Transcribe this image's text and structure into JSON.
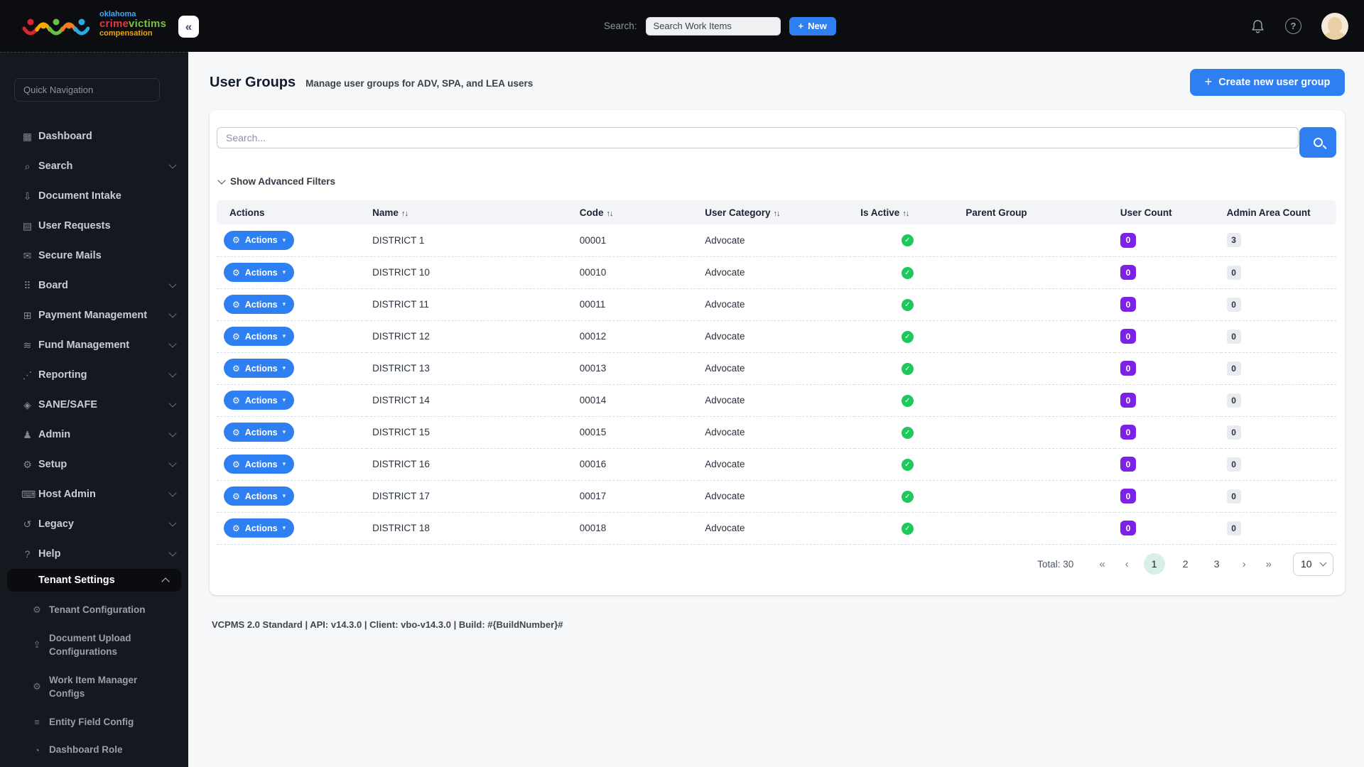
{
  "topbar": {
    "logo": {
      "line1": "oklahoma",
      "line2a": "crime",
      "line2b": "victims",
      "line3": "compensation"
    },
    "search_label": "Search:",
    "search_placeholder": "Search Work Items",
    "new_button_label": "New"
  },
  "sidebar": {
    "quick_nav_placeholder": "Quick Navigation",
    "items": [
      {
        "label": "Dashboard",
        "icon": "dashboard-icon",
        "chevron": false,
        "active": false
      },
      {
        "label": "Search",
        "icon": "search-icon",
        "chevron": true,
        "active": false
      },
      {
        "label": "Document Intake",
        "icon": "document-intake-icon",
        "chevron": false,
        "active": false
      },
      {
        "label": "User Requests",
        "icon": "user-requests-icon",
        "chevron": false,
        "active": false
      },
      {
        "label": "Secure Mails",
        "icon": "secure-mails-icon",
        "chevron": false,
        "active": false
      },
      {
        "label": "Board",
        "icon": "board-icon",
        "chevron": true,
        "active": false
      },
      {
        "label": "Payment Management",
        "icon": "payment-management-icon",
        "chevron": true,
        "active": false
      },
      {
        "label": "Fund Management",
        "icon": "fund-management-icon",
        "chevron": true,
        "active": false
      },
      {
        "label": "Reporting",
        "icon": "reporting-icon",
        "chevron": true,
        "active": false
      },
      {
        "label": "SANE/SAFE",
        "icon": "shield-icon",
        "chevron": true,
        "active": false
      },
      {
        "label": "Admin",
        "icon": "admin-icon",
        "chevron": true,
        "active": false
      },
      {
        "label": "Setup",
        "icon": "setup-icon",
        "chevron": true,
        "active": false
      },
      {
        "label": "Host Admin",
        "icon": "host-admin-icon",
        "chevron": true,
        "active": false
      },
      {
        "label": "Legacy",
        "icon": "legacy-icon",
        "chevron": true,
        "active": false
      },
      {
        "label": "Help",
        "icon": "help-icon",
        "chevron": true,
        "active": false
      },
      {
        "label": "Tenant Settings",
        "icon": null,
        "chevron": true,
        "active": true,
        "children": [
          {
            "label": "Tenant Configuration",
            "icon": "tenant-configuration-icon"
          },
          {
            "label": "Document Upload Configurations",
            "icon": "document-upload-icon"
          },
          {
            "label": "Work Item Manager Configs",
            "icon": "work-item-manager-icon"
          },
          {
            "label": "Entity Field Config",
            "icon": "entity-field-config-icon"
          },
          {
            "label": "Dashboard Role",
            "icon": "dashboard-role-icon"
          }
        ]
      }
    ]
  },
  "page": {
    "title": "User Groups",
    "subtitle": "Manage user groups for ADV, SPA, and LEA users",
    "create_button_label": "Create new user group"
  },
  "filters": {
    "search_placeholder": "Search...",
    "advanced_label": "Show Advanced Filters"
  },
  "table": {
    "headers": [
      {
        "label": "Actions",
        "sortable": false
      },
      {
        "label": "Name",
        "sortable": true
      },
      {
        "label": "Code",
        "sortable": true
      },
      {
        "label": "User Category",
        "sortable": true
      },
      {
        "label": "Is Active",
        "sortable": true
      },
      {
        "label": "Parent Group",
        "sortable": false
      },
      {
        "label": "User Count",
        "sortable": false
      },
      {
        "label": "Admin Area Count",
        "sortable": false
      }
    ],
    "actions_button_label": "Actions",
    "rows": [
      {
        "name": "DISTRICT 1",
        "code": "00001",
        "category": "Advocate",
        "active": true,
        "parent_group": "",
        "user_count": "0",
        "admin_area_count": "3"
      },
      {
        "name": "DISTRICT 10",
        "code": "00010",
        "category": "Advocate",
        "active": true,
        "parent_group": "",
        "user_count": "0",
        "admin_area_count": "0"
      },
      {
        "name": "DISTRICT 11",
        "code": "00011",
        "category": "Advocate",
        "active": true,
        "parent_group": "",
        "user_count": "0",
        "admin_area_count": "0"
      },
      {
        "name": "DISTRICT 12",
        "code": "00012",
        "category": "Advocate",
        "active": true,
        "parent_group": "",
        "user_count": "0",
        "admin_area_count": "0"
      },
      {
        "name": "DISTRICT 13",
        "code": "00013",
        "category": "Advocate",
        "active": true,
        "parent_group": "",
        "user_count": "0",
        "admin_area_count": "0"
      },
      {
        "name": "DISTRICT 14",
        "code": "00014",
        "category": "Advocate",
        "active": true,
        "parent_group": "",
        "user_count": "0",
        "admin_area_count": "0"
      },
      {
        "name": "DISTRICT 15",
        "code": "00015",
        "category": "Advocate",
        "active": true,
        "parent_group": "",
        "user_count": "0",
        "admin_area_count": "0"
      },
      {
        "name": "DISTRICT 16",
        "code": "00016",
        "category": "Advocate",
        "active": true,
        "parent_group": "",
        "user_count": "0",
        "admin_area_count": "0"
      },
      {
        "name": "DISTRICT 17",
        "code": "00017",
        "category": "Advocate",
        "active": true,
        "parent_group": "",
        "user_count": "0",
        "admin_area_count": "0"
      },
      {
        "name": "DISTRICT 18",
        "code": "00018",
        "category": "Advocate",
        "active": true,
        "parent_group": "",
        "user_count": "0",
        "admin_area_count": "0"
      }
    ]
  },
  "pagination": {
    "total_label": "Total: 30",
    "pages": [
      "1",
      "2",
      "3"
    ],
    "active_page": "1",
    "page_size": "10"
  },
  "footer": {
    "text": "VCPMS 2.0 Standard | API: v14.3.0 | Client: vbo-v14.3.0 | Build: #{BuildNumber}#"
  },
  "colors": {
    "accent_blue": "#2d7ff2",
    "badge_purple": "#7b21e8",
    "active_green": "#1ec85c",
    "topbar": "#0b0d11",
    "sidebar": "#15181e"
  }
}
